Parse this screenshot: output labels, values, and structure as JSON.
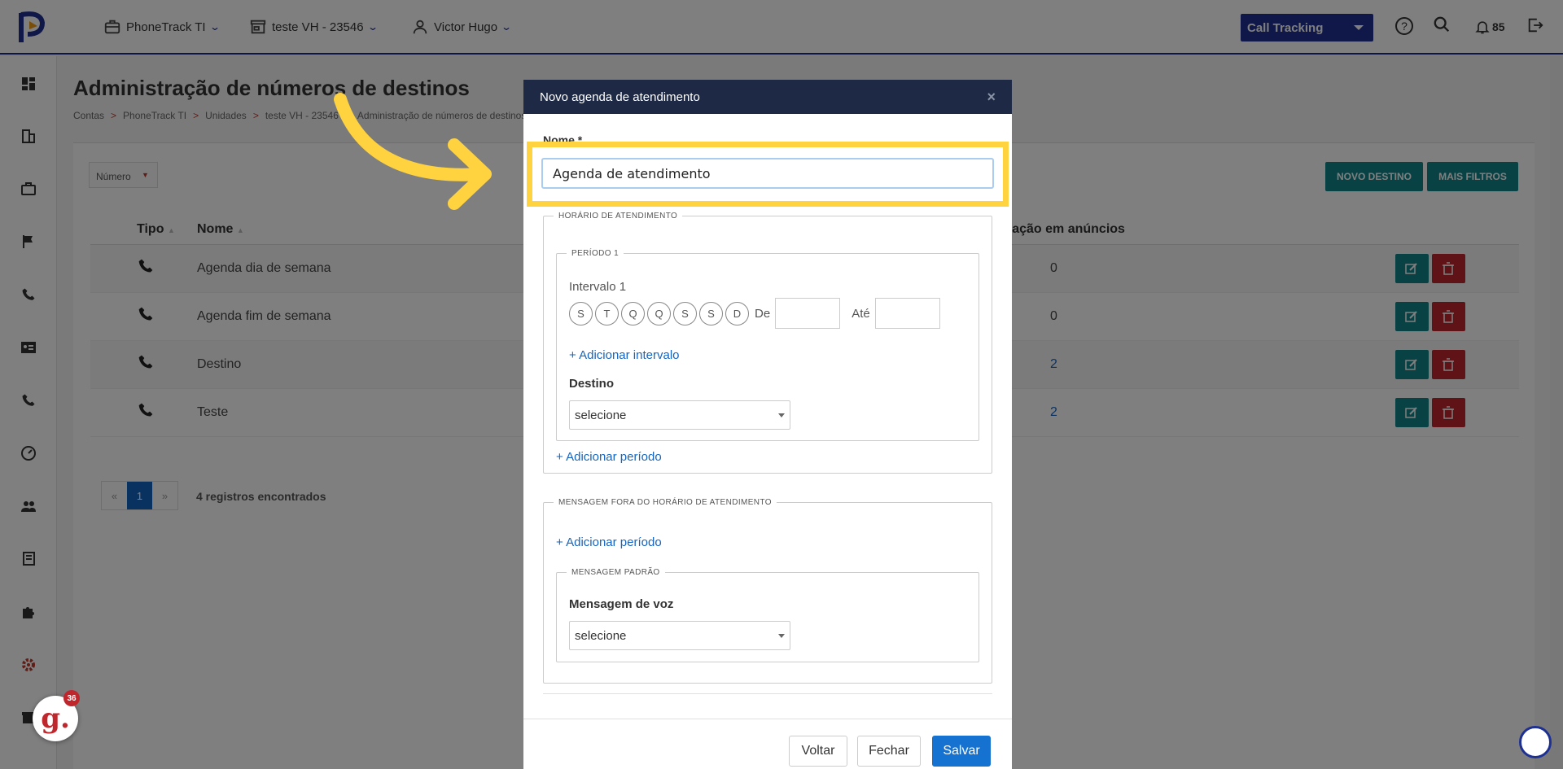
{
  "topbar": {
    "account": "PhoneTrack TI",
    "unit": "teste VH - 23546",
    "user": "Victor Hugo",
    "product": "Call Tracking",
    "notifications": "85"
  },
  "page": {
    "title": "Administração de números de destinos",
    "breadcrumb": [
      "Contas",
      "PhoneTrack TI",
      "Unidades",
      "teste VH - 23546",
      "Administração de números de destinos"
    ]
  },
  "filters": {
    "field": "Número",
    "new_button": "NOVO DESTINO",
    "more_button": "MAIS FILTROS"
  },
  "table": {
    "headers": [
      "Tipo",
      "Nome",
      "Utilização em anúncios"
    ],
    "rows": [
      {
        "name": "Agenda dia de semana",
        "usage": "0"
      },
      {
        "name": "Agenda fim de semana",
        "usage": "0"
      },
      {
        "name": "Destino",
        "usage": "2"
      },
      {
        "name": "Teste",
        "usage": "2"
      }
    ]
  },
  "pagination": {
    "prev": "«",
    "current": "1",
    "next": "»",
    "records": "4 registros encontrados"
  },
  "modal": {
    "title": "Novo agenda de atendimento",
    "close": "×",
    "name_label": "Nome *",
    "name_value": "Agenda de atendimento",
    "schedule_legend": "HORÁRIO DE ATENDIMENTO",
    "period_legend": "PERÍODO 1",
    "interval_label": "Intervalo 1",
    "days": [
      "S",
      "T",
      "Q",
      "Q",
      "S",
      "S",
      "D"
    ],
    "from_label": "De",
    "to_label": "Até",
    "add_interval": "Adicionar intervalo",
    "destination_label": "Destino",
    "destination_value": "selecione",
    "add_period": "Adicionar período",
    "offhours_legend": "MENSAGEM FORA DO HORÁRIO DE ATENDIMENTO",
    "add_period_2": "Adicionar período",
    "default_msg_legend": "MENSAGEM PADRÃO",
    "voice_msg_label": "Mensagem de voz",
    "voice_msg_value": "selecione",
    "back": "Voltar",
    "close_btn": "Fechar",
    "save": "Salvar"
  },
  "widget": {
    "letter": "g.",
    "count": "36"
  },
  "colors": {
    "brand_blue": "#1e3192",
    "teal": "#13858b",
    "danger": "#c0272d",
    "highlight": "#ffd23f"
  }
}
